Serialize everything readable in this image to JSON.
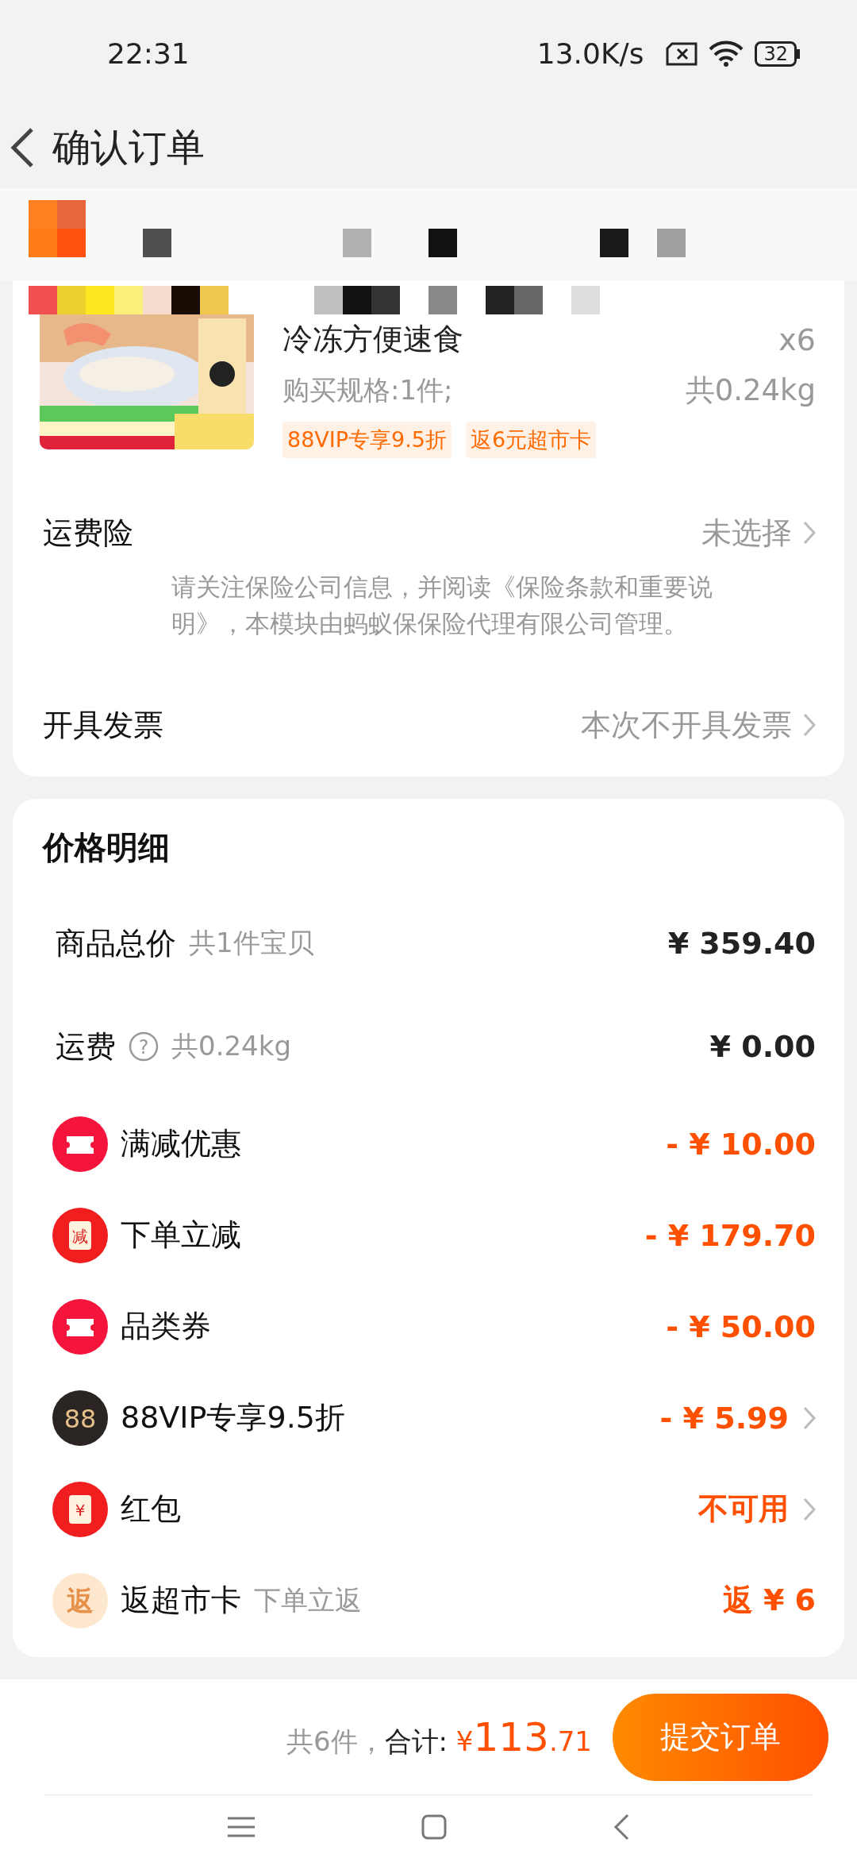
{
  "status_bar": {
    "time": "22:31",
    "network_speed": "13.0K/s",
    "battery": "32"
  },
  "header": {
    "title": "确认订单"
  },
  "product": {
    "title": "冷冻方便速食",
    "quantity": "x6",
    "spec": "购买规格:1件;",
    "weight": "共0.24kg",
    "tags": [
      "88VIP专享9.5折",
      "返6元超市卡"
    ]
  },
  "options": [
    {
      "label": "运费险",
      "value": "未选择",
      "note": "请关注保险公司信息，并阅读《保险条款和重要说明》，本模块由蚂蚁保保险代理有限公司管理。"
    },
    {
      "label": "开具发票",
      "value": "本次不开具发票"
    }
  ],
  "price_detail": {
    "title": "价格明细",
    "rows": [
      {
        "kind": "plain",
        "label": "商品总价",
        "sub": "共1件宝贝",
        "value": "¥ 359.40"
      },
      {
        "kind": "help",
        "label": "运费",
        "help_icon": "?",
        "sub": "共0.24kg",
        "value": "¥ 0.00"
      },
      {
        "kind": "discount",
        "icon": {
          "kind": "ticket"
        },
        "label": "满减优惠",
        "value": "- ¥ 10.00",
        "chevron": false
      },
      {
        "kind": "discount",
        "icon": {
          "kind": "label",
          "text": "减"
        },
        "label": "下单立减",
        "value": "- ¥ 179.70",
        "chevron": false
      },
      {
        "kind": "discount",
        "icon": {
          "kind": "ticket"
        },
        "label": "品类券",
        "value": "- ¥ 50.00",
        "chevron": false
      },
      {
        "kind": "discount",
        "icon": {
          "kind": "vip",
          "text": "88"
        },
        "label": "88VIP专享9.5折",
        "value": "- ¥ 5.99",
        "chevron": true
      },
      {
        "kind": "discount",
        "icon": {
          "kind": "label",
          "text": "¥"
        },
        "label": "红包",
        "value": "不可用",
        "chevron": true
      },
      {
        "kind": "discount",
        "icon": {
          "kind": "rebate",
          "text": "返"
        },
        "label": "返超市卡",
        "sub": "下单立返",
        "value": "返 ¥ 6",
        "chevron": false
      }
    ]
  },
  "footer": {
    "count": "共6件，",
    "total_label": "合计:",
    "currency": "¥",
    "integer": "113",
    "decimal": ".71",
    "submit": "提交订单"
  }
}
